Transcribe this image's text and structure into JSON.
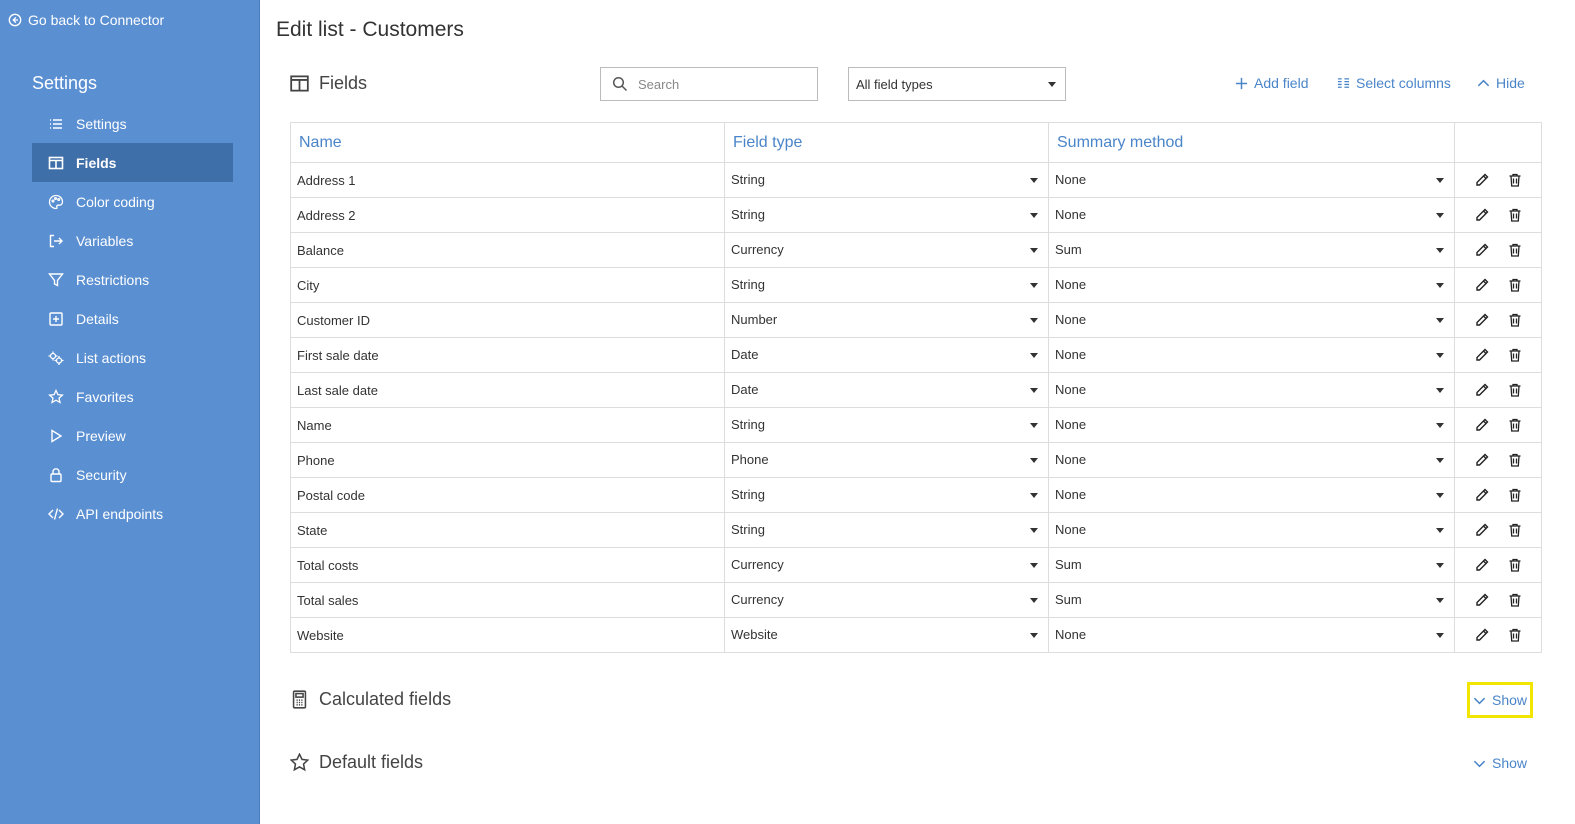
{
  "sidebar": {
    "back_label": "Go back to Connector",
    "title": "Settings",
    "items": [
      {
        "label": "Settings",
        "icon": "list-icon",
        "active": false
      },
      {
        "label": "Fields",
        "icon": "columns-icon",
        "active": true
      },
      {
        "label": "Color coding",
        "icon": "palette-icon",
        "active": false
      },
      {
        "label": "Variables",
        "icon": "arrow-out-icon",
        "active": false
      },
      {
        "label": "Restrictions",
        "icon": "filter-icon",
        "active": false
      },
      {
        "label": "Details",
        "icon": "plus-square-icon",
        "active": false
      },
      {
        "label": "List actions",
        "icon": "gears-icon",
        "active": false
      },
      {
        "label": "Favorites",
        "icon": "star-icon",
        "active": false
      },
      {
        "label": "Preview",
        "icon": "play-icon",
        "active": false
      },
      {
        "label": "Security",
        "icon": "lock-icon",
        "active": false
      },
      {
        "label": "API endpoints",
        "icon": "code-icon",
        "active": false
      }
    ]
  },
  "page_title": "Edit list - Customers",
  "fields_section": {
    "title": "Fields",
    "search_placeholder": "Search",
    "type_filter": "All field types",
    "add_field_label": "Add field",
    "select_columns_label": "Select columns",
    "hide_label": "Hide"
  },
  "table": {
    "headers": {
      "name": "Name",
      "field_type": "Field type",
      "summary_method": "Summary method"
    },
    "rows": [
      {
        "name": "Address 1",
        "type": "String",
        "summary": "None"
      },
      {
        "name": "Address 2",
        "type": "String",
        "summary": "None"
      },
      {
        "name": "Balance",
        "type": "Currency",
        "summary": "Sum"
      },
      {
        "name": "City",
        "type": "String",
        "summary": "None"
      },
      {
        "name": "Customer ID",
        "type": "Number",
        "summary": "None"
      },
      {
        "name": "First sale date",
        "type": "Date",
        "summary": "None"
      },
      {
        "name": "Last sale date",
        "type": "Date",
        "summary": "None"
      },
      {
        "name": "Name",
        "type": "String",
        "summary": "None"
      },
      {
        "name": "Phone",
        "type": "Phone",
        "summary": "None"
      },
      {
        "name": "Postal code",
        "type": "String",
        "summary": "None"
      },
      {
        "name": "State",
        "type": "String",
        "summary": "None"
      },
      {
        "name": "Total costs",
        "type": "Currency",
        "summary": "Sum"
      },
      {
        "name": "Total sales",
        "type": "Currency",
        "summary": "Sum"
      },
      {
        "name": "Website",
        "type": "Website",
        "summary": "None"
      }
    ]
  },
  "calculated_section": {
    "title": "Calculated fields",
    "show_label": "Show"
  },
  "default_section": {
    "title": "Default fields",
    "show_label": "Show"
  },
  "colors": {
    "sidebar": "#5a8fd1",
    "sidebar_active": "#3f6fa8",
    "link": "#4a85c9",
    "highlight": "#f2e600"
  }
}
